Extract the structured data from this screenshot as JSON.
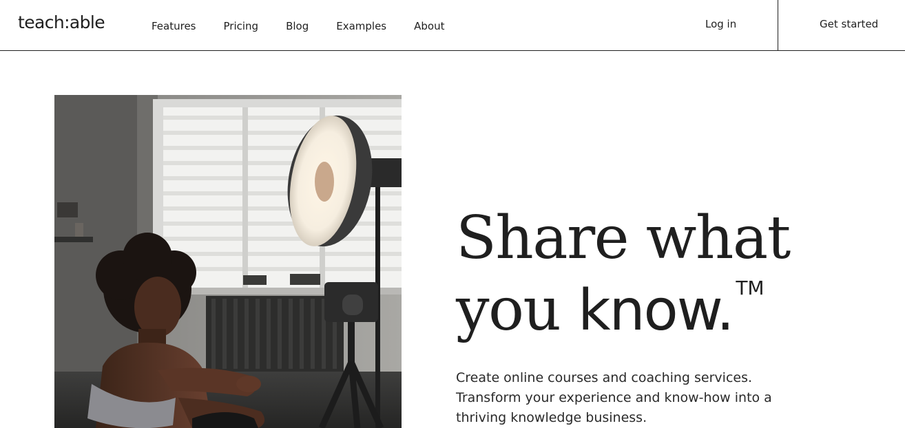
{
  "header": {
    "logo": "teach:able",
    "nav": [
      "Features",
      "Pricing",
      "Blog",
      "Examples",
      "About"
    ],
    "login_label": "Log in",
    "cta_label": "Get started"
  },
  "hero": {
    "headline_line1": "Share what",
    "headline_line2_serif": "you ",
    "headline_line2_sans": "know.",
    "trademark": "TM",
    "subcopy_lines": [
      "Create online courses and coaching services.",
      "Transform your experience and know-how into a",
      "thriving knowledge business."
    ]
  },
  "colors": {
    "text": "#1f1f1f",
    "background": "#ffffff"
  }
}
